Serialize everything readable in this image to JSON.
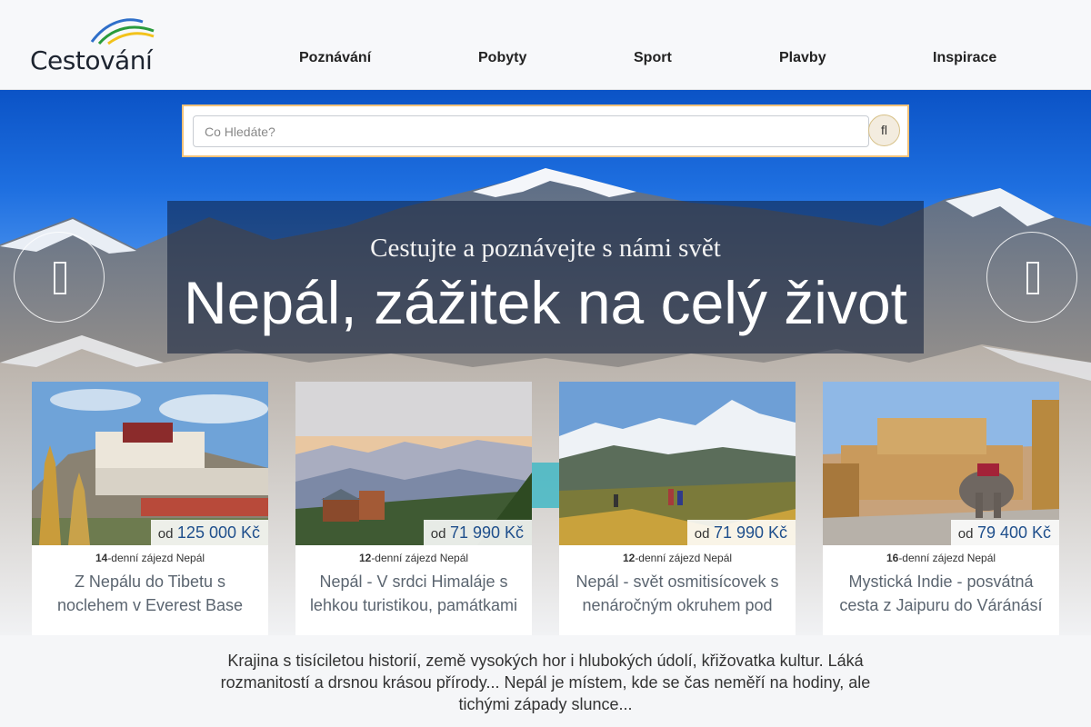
{
  "header": {
    "logo_text": "Cestování",
    "nav": [
      "Poznávání",
      "Pobyty",
      "Sport",
      "Plavby",
      "Inspirace"
    ]
  },
  "search": {
    "placeholder": "Co Hledáte?",
    "button_icon": "fl",
    "button_icon_name": "search-icon"
  },
  "banner": {
    "subtitle": "Cestujte a poznávejte s námi svět",
    "title": "Nepál, zážitek na celý život"
  },
  "carousel": {
    "prev_icon": "arrow-left-icon",
    "next_icon": "arrow-right-icon"
  },
  "cards": [
    {
      "price_prefix": "od",
      "price": "125 000 Kč",
      "days": "14",
      "days_suffix": "-denní zájezd Nepál",
      "title": "Z Nepálu do Tibetu s noclehem v Everest Base"
    },
    {
      "price_prefix": "od",
      "price": "71 990 Kč",
      "days": "12",
      "days_suffix": "-denní zájezd Nepál",
      "title": "Nepál - V srdci Himaláje s lehkou turistikou, památkami"
    },
    {
      "price_prefix": "od",
      "price": "71 990 Kč",
      "days": "12",
      "days_suffix": "-denní zájezd Nepál",
      "title": "Nepál - svět osmitisícovek s nenáročným okruhem pod"
    },
    {
      "price_prefix": "od",
      "price": "79 400 Kč",
      "days": "16",
      "days_suffix": "-denní zájezd Nepál",
      "title": "Mystická Indie - posvátná cesta z Jaipuru do Váránásí"
    }
  ],
  "description": "Krajina s tisíciletou historií, země vysokých hor i hlubokých údolí, křižovatka kultur. Láká rozmanitostí a drsnou krásou přírody... Nepál je místem, kde se čas neměří na hodiny, ale tichými západy slunce...",
  "colors": {
    "accent_border": "#f2c27a",
    "price_text": "#1f4f8c",
    "sky": "#1e6fe0"
  }
}
